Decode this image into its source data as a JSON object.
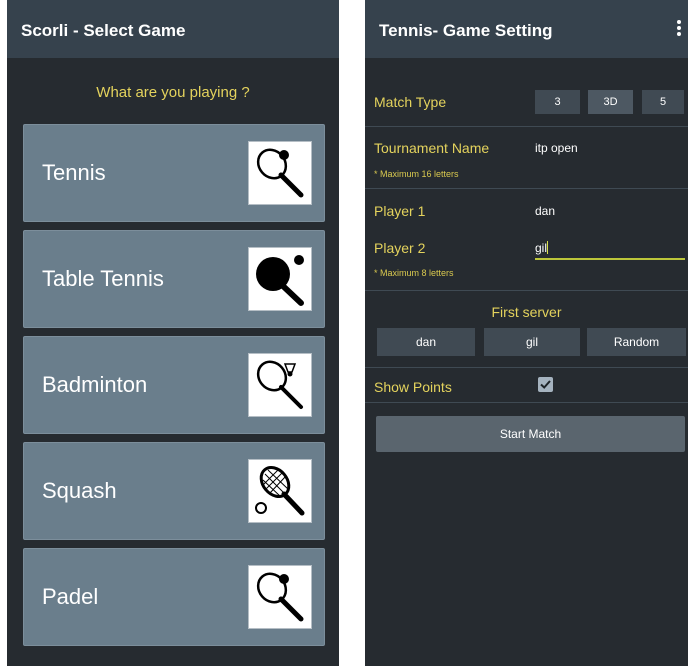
{
  "select_screen": {
    "appbar_title": "Scorli - Select Game",
    "prompt": "What are you playing ?",
    "games": [
      {
        "label": "Tennis",
        "icon": "tennis-racket-icon"
      },
      {
        "label": "Table Tennis",
        "icon": "table-tennis-paddle-icon"
      },
      {
        "label": "Badminton",
        "icon": "badminton-racket-icon"
      },
      {
        "label": "Squash",
        "icon": "squash-racket-icon"
      },
      {
        "label": "Padel",
        "icon": "padel-racket-icon"
      }
    ]
  },
  "settings_screen": {
    "appbar_title": "Tennis- Game Setting",
    "menu_icon": "more-vert-icon",
    "match_type": {
      "label": "Match Type",
      "options": [
        "3",
        "3D",
        "5"
      ],
      "selected": "3D"
    },
    "tournament": {
      "label": "Tournament Name",
      "value": "itp open",
      "hint": "* Maximum 16 letters"
    },
    "player1": {
      "label": "Player 1",
      "value": "dan"
    },
    "player2": {
      "label": "Player 2",
      "value": "gil",
      "hint": "* Maximum 8 letters"
    },
    "first_server": {
      "label": "First server",
      "options": [
        "dan",
        "gil",
        "Random"
      ]
    },
    "show_points": {
      "label": "Show Points",
      "checked": true
    },
    "start_button": "Start Match"
  },
  "colors": {
    "background": "#262b30",
    "appbar": "#36424d",
    "card": "#6a7e8c",
    "accent": "#e4d35d",
    "button": "#404a53"
  }
}
